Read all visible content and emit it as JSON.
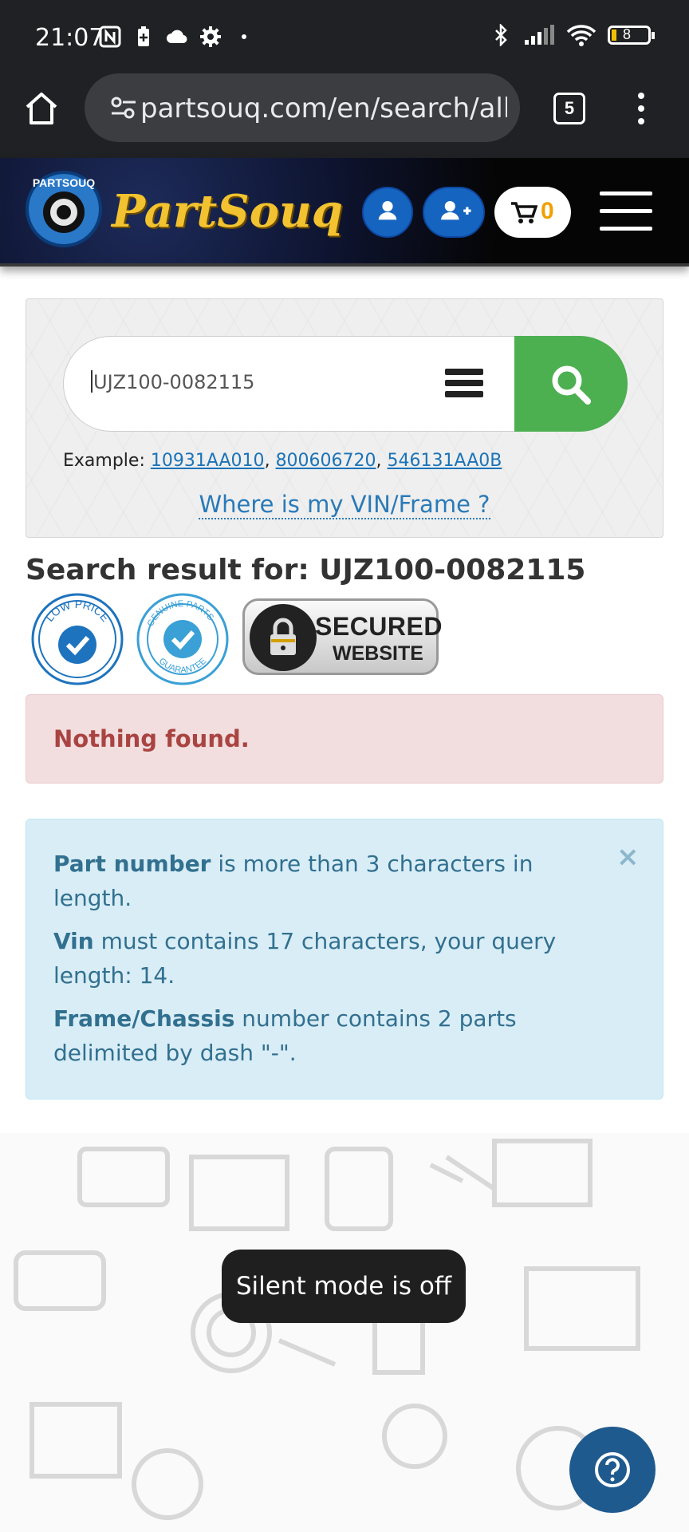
{
  "status_bar": {
    "time": "21:07",
    "battery": "8"
  },
  "browser": {
    "url": "partsouq.com/en/search/all?",
    "tab_count": "5"
  },
  "header": {
    "logo_text": "PartSouq",
    "cart_count": "0"
  },
  "search": {
    "value": "UJZ100-0082115",
    "example_label": "Example:",
    "examples": [
      "10931AA010",
      "800606720",
      "546131AA0B"
    ],
    "vin_link": "Where is my VIN/Frame ?"
  },
  "result": {
    "title": "Search result for: UJZ100-0082115",
    "badges": {
      "low_price": "LOW PRICE",
      "genuine_top": "GENUINE PARTS",
      "genuine_bottom": "GUARANTEE",
      "secured_1": "SECURED",
      "secured_2": "WEBSITE"
    },
    "nothing_found": "Nothing found."
  },
  "info": {
    "items": [
      {
        "bold": "Part number",
        "text": " is more than 3 characters in length."
      },
      {
        "bold": "Vin",
        "text": " must contains 17 characters, your query length: 14."
      },
      {
        "bold": "Frame/Chassis",
        "text": " number contains 2 parts delimited by dash \"-\"."
      }
    ],
    "close": "×"
  },
  "toast": "Silent mode is off",
  "colors": {
    "search_green": "#4caf50",
    "header_blue": "#1565c0",
    "danger_text": "#a94442",
    "info_text": "#31708f",
    "help_blue": "#1f5a8f"
  }
}
